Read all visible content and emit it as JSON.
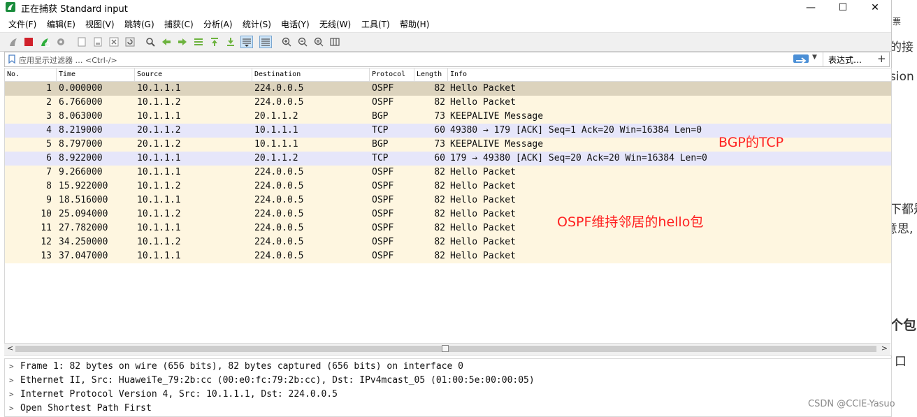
{
  "window": {
    "title": "正在捕获 Standard input",
    "minimize": "—",
    "maximize": "☐",
    "close": "✕"
  },
  "menu": [
    "文件(F)",
    "编辑(E)",
    "视图(V)",
    "跳转(G)",
    "捕获(C)",
    "分析(A)",
    "统计(S)",
    "电话(Y)",
    "无线(W)",
    "工具(T)",
    "帮助(H)"
  ],
  "toolbar": {
    "icons": [
      "shark-start-icon",
      "stop-capture-icon",
      "restart-capture-icon",
      "capture-options-icon",
      "open-file-icon",
      "save-file-icon",
      "close-file-icon",
      "reload-icon",
      "find-packet-icon",
      "go-back-icon",
      "go-forward-icon",
      "go-to-packet-icon",
      "first-packet-icon",
      "last-packet-icon",
      "autoscroll-icon",
      "colorize-icon",
      "zoom-in-icon",
      "zoom-out-icon",
      "zoom-normal-icon",
      "resize-columns-icon"
    ],
    "active": [
      "autoscroll-icon",
      "colorize-icon"
    ]
  },
  "filter": {
    "placeholder": "应用显示过滤器 … <Ctrl-/>",
    "expression_label": "表达式…",
    "add_label": "+"
  },
  "columns": [
    "No.",
    "Time",
    "Source",
    "Destination",
    "Protocol",
    "Length",
    "Info"
  ],
  "colors": {
    "selected": "#dcd3bd",
    "ospf_bgp": "#fef6e0",
    "tcp": "#e6e6fa"
  },
  "packets": [
    {
      "no": "1",
      "time": "0.000000",
      "src": "10.1.1.1",
      "dst": "224.0.0.5",
      "proto": "OSPF",
      "len": "82",
      "info": "Hello Packet",
      "color": "selected"
    },
    {
      "no": "2",
      "time": "6.766000",
      "src": "10.1.1.2",
      "dst": "224.0.0.5",
      "proto": "OSPF",
      "len": "82",
      "info": "Hello Packet",
      "color": "ospf_bgp"
    },
    {
      "no": "3",
      "time": "8.063000",
      "src": "10.1.1.1",
      "dst": "20.1.1.2",
      "proto": "BGP",
      "len": "73",
      "info": "KEEPALIVE Message",
      "color": "ospf_bgp"
    },
    {
      "no": "4",
      "time": "8.219000",
      "src": "20.1.1.2",
      "dst": "10.1.1.1",
      "proto": "TCP",
      "len": "60",
      "info": "49380 → 179 [ACK] Seq=1 Ack=20 Win=16384 Len=0",
      "color": "tcp"
    },
    {
      "no": "5",
      "time": "8.797000",
      "src": "20.1.1.2",
      "dst": "10.1.1.1",
      "proto": "BGP",
      "len": "73",
      "info": "KEEPALIVE Message",
      "color": "ospf_bgp"
    },
    {
      "no": "6",
      "time": "8.922000",
      "src": "10.1.1.1",
      "dst": "20.1.1.2",
      "proto": "TCP",
      "len": "60",
      "info": "179 → 49380 [ACK] Seq=20 Ack=20 Win=16384 Len=0",
      "color": "tcp"
    },
    {
      "no": "7",
      "time": "9.266000",
      "src": "10.1.1.1",
      "dst": "224.0.0.5",
      "proto": "OSPF",
      "len": "82",
      "info": "Hello Packet",
      "color": "ospf_bgp"
    },
    {
      "no": "8",
      "time": "15.922000",
      "src": "10.1.1.2",
      "dst": "224.0.0.5",
      "proto": "OSPF",
      "len": "82",
      "info": "Hello Packet",
      "color": "ospf_bgp"
    },
    {
      "no": "9",
      "time": "18.516000",
      "src": "10.1.1.1",
      "dst": "224.0.0.5",
      "proto": "OSPF",
      "len": "82",
      "info": "Hello Packet",
      "color": "ospf_bgp"
    },
    {
      "no": "10",
      "time": "25.094000",
      "src": "10.1.1.2",
      "dst": "224.0.0.5",
      "proto": "OSPF",
      "len": "82",
      "info": "Hello Packet",
      "color": "ospf_bgp"
    },
    {
      "no": "11",
      "time": "27.782000",
      "src": "10.1.1.1",
      "dst": "224.0.0.5",
      "proto": "OSPF",
      "len": "82",
      "info": "Hello Packet",
      "color": "ospf_bgp"
    },
    {
      "no": "12",
      "time": "34.250000",
      "src": "10.1.1.2",
      "dst": "224.0.0.5",
      "proto": "OSPF",
      "len": "82",
      "info": "Hello Packet",
      "color": "ospf_bgp"
    },
    {
      "no": "13",
      "time": "37.047000",
      "src": "10.1.1.1",
      "dst": "224.0.0.5",
      "proto": "OSPF",
      "len": "82",
      "info": "Hello Packet",
      "color": "ospf_bgp"
    }
  ],
  "details": [
    "Frame 1: 82 bytes on wire (656 bits), 82 bytes captured (656 bits) on interface 0",
    "Ethernet II, Src: HuaweiTe_79:2b:cc (00:e0:fc:79:2b:cc), Dst: IPv4mcast_05 (01:00:5e:00:00:05)",
    "Internet Protocol Version 4, Src: 10.1.1.1, Dst: 224.0.0.5",
    "Open Shortest Path First"
  ],
  "annotations": {
    "bgp_tcp": "BGP的TCP",
    "ospf_hello": "OSPF维持邻居的hello包"
  },
  "watermark": "CSDN @CCIE-Yasuo",
  "background_fragments": [
    "票",
    "的接",
    "sion",
    "下都是",
    "意思,",
    "个包",
    "口"
  ]
}
